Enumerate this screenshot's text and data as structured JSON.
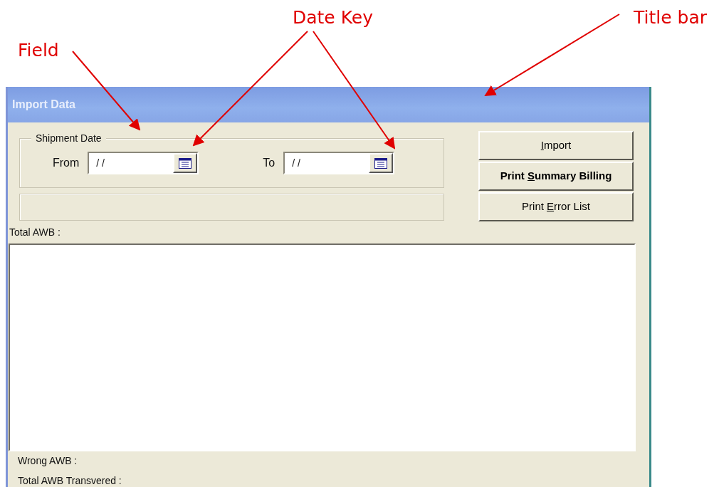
{
  "annotations": [
    {
      "text": "Field"
    },
    {
      "text": "Date Key"
    },
    {
      "text": "Title bar"
    }
  ],
  "window": {
    "title": "Import Data"
  },
  "shipment_date": {
    "legend": "Shipment Date",
    "fields": [
      {
        "label": "From",
        "value": "/ /"
      },
      {
        "label": "To",
        "value": "/ /"
      }
    ]
  },
  "buttons": [
    {
      "key": "I",
      "post": "mport"
    },
    {
      "pre": "Print ",
      "key": "S",
      "post": "ummary Billing"
    },
    {
      "pre": "Print ",
      "key": "E",
      "post": "rror List"
    }
  ],
  "total_awb": "Total AWB :",
  "footer": [
    "Wrong AWB :",
    "Total AWB Transvered :"
  ]
}
